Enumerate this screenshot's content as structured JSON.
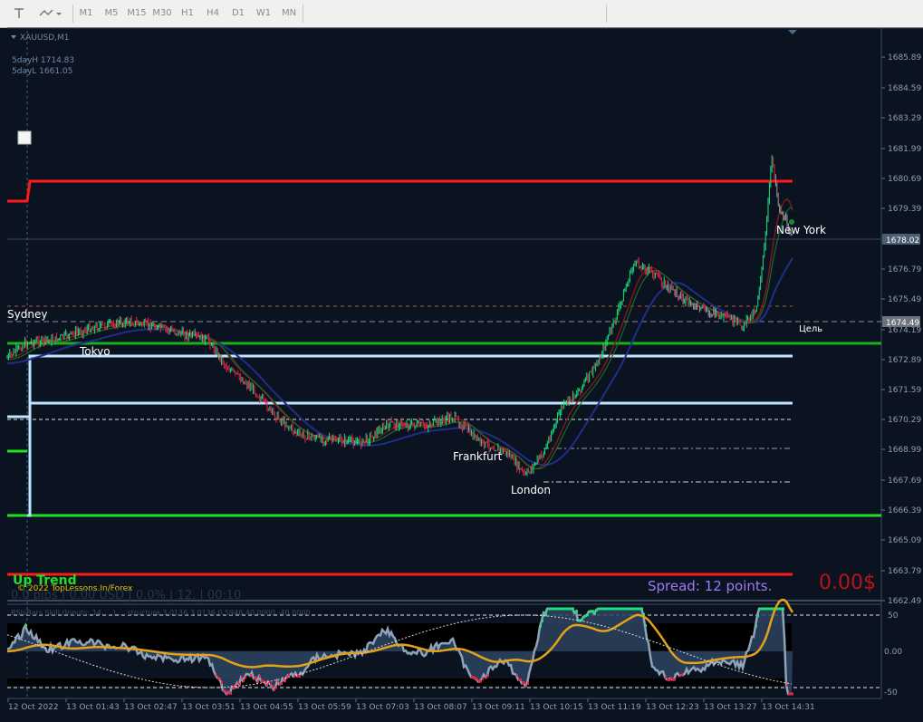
{
  "toolbar": {
    "timeframes": [
      "M1",
      "M5",
      "M15",
      "M30",
      "H1",
      "H4",
      "D1",
      "W1",
      "MN"
    ]
  },
  "chart": {
    "symbol": "XAUUSD,M1",
    "info_high": "5dayH 1714.83",
    "info_low": "5dayL 1661.05",
    "sessions": [
      "Sydney",
      "Tokyo",
      "Frankfurt",
      "London",
      "New York"
    ],
    "target_label": "Цель",
    "trend_label": "Up Trend",
    "copyright": "© 2022 TopLessons.In/Forex",
    "stats": "0.0 pips | 0.00 USD | 0.0% | 12. | 00:10",
    "spread": "Spread: 12 points.",
    "profit": "0.00$",
    "indicator_caption": "RSIsBars Skill (Inputs: 14 ... ) ... structure 3 0136 3 0136 0 5946 40 0000 -40 0000",
    "price_box_current": "1678.02",
    "price_box_target": "1674.49",
    "price_ticks": [
      "1685.89",
      "1684.59",
      "1683.29",
      "1681.99",
      "1680.69",
      "1679.39",
      "1676.79",
      "1675.49",
      "1674.19",
      "1672.89",
      "1671.59",
      "1670.29",
      "1668.99",
      "1667.69",
      "1666.39",
      "1665.09",
      "1663.79",
      "1662.49"
    ],
    "indicator_ticks": [
      "50",
      "0.00",
      "-50"
    ],
    "time_ticks": [
      "12 Oct 2022",
      "13 Oct 01:43",
      "13 Oct 02:47",
      "13 Oct 03:51",
      "13 Oct 04:55",
      "13 Oct 05:59",
      "13 Oct 07:03",
      "13 Oct 08:07",
      "13 Oct 09:11",
      "13 Oct 10:15",
      "13 Oct 11:19",
      "13 Oct 12:23",
      "13 Oct 13:27",
      "13 Oct 14:31"
    ],
    "colors": {
      "background": "#0b1220",
      "bull": "#19e27a",
      "bear": "#e5254a",
      "resistance": "#ff1a1a",
      "support": "#17b21a",
      "level_light": "#bfe4ff",
      "trend_text": "#22e022",
      "spread_text": "#9a7cf3",
      "profit_text": "#b8141a"
    }
  }
}
